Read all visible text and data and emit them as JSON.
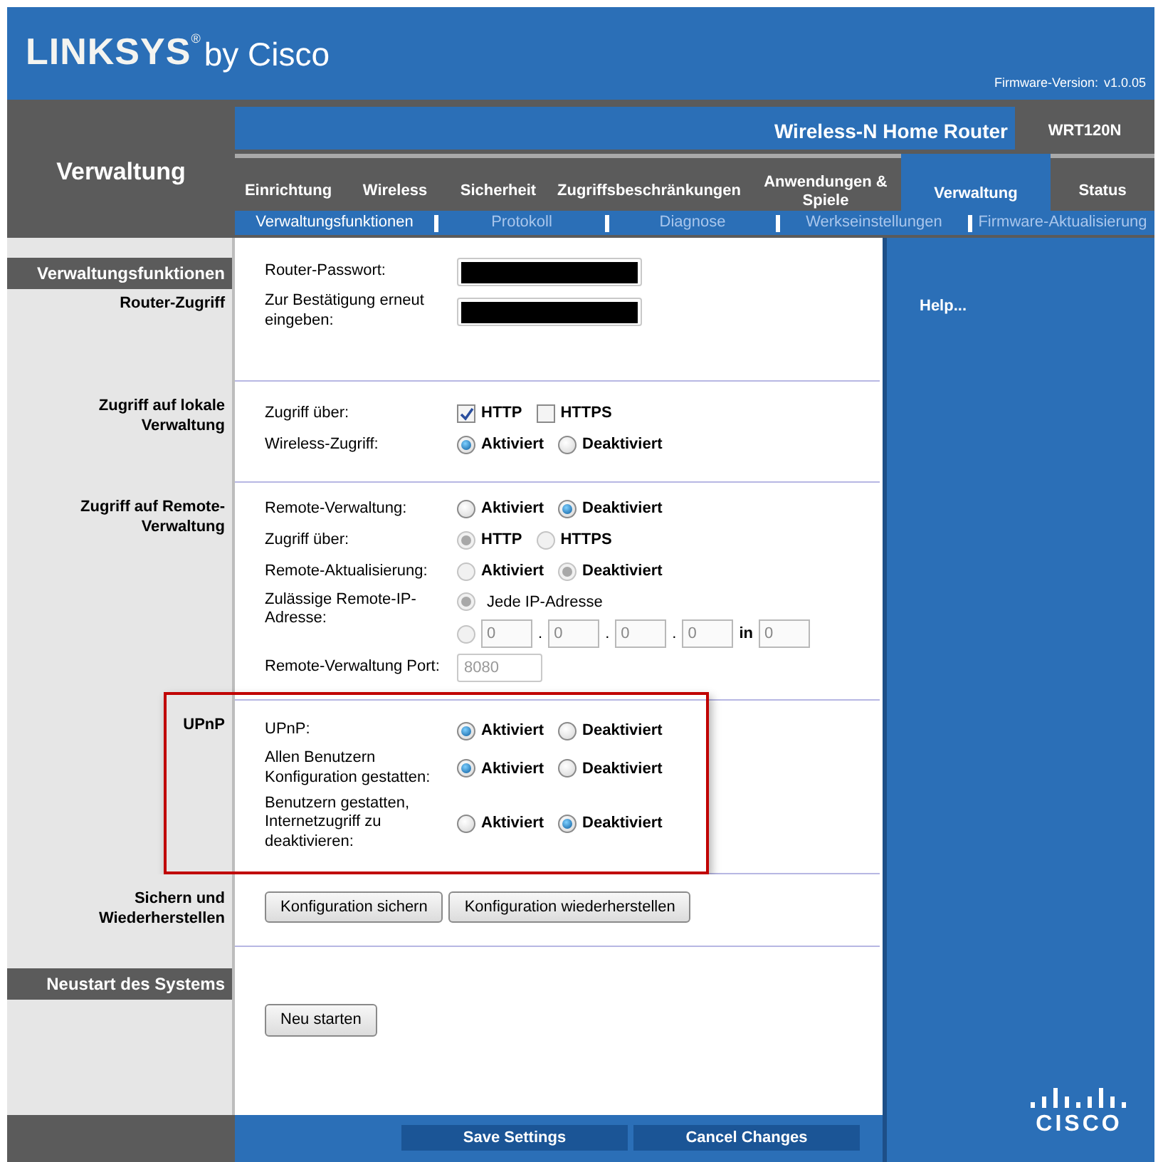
{
  "header": {
    "brand": "LINKSYS",
    "brand_mark": "®",
    "brand_suffix": "by Cisco",
    "firmware_label": "Firmware-Version:",
    "firmware_version": "v1.0.05"
  },
  "page_title": "Verwaltung",
  "product_name": "Wireless-N Home Router",
  "model": "WRT120N",
  "tabs": [
    {
      "label": "Einrichtung",
      "selected": false
    },
    {
      "label": "Wireless",
      "selected": false
    },
    {
      "label": "Sicherheit",
      "selected": false
    },
    {
      "label": "Zugriffsbeschränkungen",
      "selected": false
    },
    {
      "label": "Anwendungen & Spiele",
      "selected": false
    },
    {
      "label": "Verwaltung",
      "selected": true
    },
    {
      "label": "Status",
      "selected": false
    }
  ],
  "subtabs": [
    {
      "label": "Verwaltungsfunktionen",
      "selected": true
    },
    {
      "label": "Protokoll",
      "selected": false
    },
    {
      "label": "Diagnose",
      "selected": false
    },
    {
      "label": "Werkseinstellungen",
      "selected": false
    },
    {
      "label": "Firmware-Aktualisierung",
      "selected": false
    }
  ],
  "sections": [
    {
      "group_header": "Verwaltungsfunktionen",
      "label": "Router-Zugriff",
      "highlighted": false,
      "rows": [
        {
          "kind": "password",
          "label": "Router-Passwort:",
          "redacted": true
        },
        {
          "kind": "password",
          "label": "Zur Bestätigung erneut eingeben:",
          "redacted": true
        }
      ]
    },
    {
      "label": "Zugriff auf lokale Verwaltung",
      "highlighted": false,
      "rows": [
        {
          "kind": "checkboxes",
          "label": "Zugriff über:",
          "options": [
            {
              "label": "HTTP",
              "checked": true
            },
            {
              "label": "HTTPS",
              "checked": false
            }
          ]
        },
        {
          "kind": "radios",
          "label": "Wireless-Zugriff:",
          "disabled": false,
          "options": [
            {
              "label": "Aktiviert",
              "selected": true
            },
            {
              "label": "Deaktiviert",
              "selected": false
            }
          ]
        }
      ]
    },
    {
      "label": "Zugriff auf Remote-Verwaltung",
      "highlighted": false,
      "rows": [
        {
          "kind": "radios",
          "label": "Remote-Verwaltung:",
          "disabled": false,
          "options": [
            {
              "label": "Aktiviert",
              "selected": false
            },
            {
              "label": "Deaktiviert",
              "selected": true
            }
          ]
        },
        {
          "kind": "radios",
          "label": "Zugriff über:",
          "disabled": true,
          "options": [
            {
              "label": "HTTP",
              "selected": true
            },
            {
              "label": "HTTPS",
              "selected": false
            }
          ]
        },
        {
          "kind": "radios",
          "label": "Remote-Aktualisierung:",
          "disabled": true,
          "options": [
            {
              "label": "Aktiviert",
              "selected": false
            },
            {
              "label": "Deaktiviert",
              "selected": true
            }
          ]
        },
        {
          "kind": "ip",
          "label": "Zulässige Remote-IP-Adresse:",
          "disabled": true,
          "any_option": {
            "label": "Jede IP-Adresse",
            "selected": true
          },
          "range_option": {
            "selected": false,
            "octets": [
              "0",
              "0",
              "0",
              "0"
            ],
            "separator": ".",
            "range_word": "in",
            "range_end": "0"
          }
        },
        {
          "kind": "text",
          "label": "Remote-Verwaltung Port:",
          "disabled": true,
          "value": "8080"
        }
      ]
    },
    {
      "label": "UPnP",
      "highlighted": true,
      "rows": [
        {
          "kind": "radios",
          "label": "UPnP:",
          "disabled": false,
          "options": [
            {
              "label": "Aktiviert",
              "selected": true
            },
            {
              "label": "Deaktiviert",
              "selected": false
            }
          ]
        },
        {
          "kind": "radios",
          "label": "Allen Benutzern Konfiguration gestatten:",
          "disabled": false,
          "options": [
            {
              "label": "Aktiviert",
              "selected": true
            },
            {
              "label": "Deaktiviert",
              "selected": false
            }
          ]
        },
        {
          "kind": "radios",
          "label": "Benutzern gestatten, Internetzugriff zu deaktivieren:",
          "disabled": false,
          "options": [
            {
              "label": "Aktiviert",
              "selected": false
            },
            {
              "label": "Deaktiviert",
              "selected": true
            }
          ]
        }
      ]
    },
    {
      "label": "Sichern und Wiederherstellen",
      "highlighted": false,
      "rows": [
        {
          "kind": "buttons",
          "buttons": [
            "Konfiguration sichern",
            "Konfiguration wiederherstellen"
          ]
        }
      ]
    },
    {
      "group_header": "Neustart des Systems",
      "highlighted": false,
      "rows": [
        {
          "kind": "buttons",
          "buttons": [
            "Neu starten"
          ]
        }
      ]
    }
  ],
  "help": {
    "link": "Help..."
  },
  "footer_buttons": [
    "Save Settings",
    "Cancel Changes"
  ],
  "footer_logo": "CISCO"
}
